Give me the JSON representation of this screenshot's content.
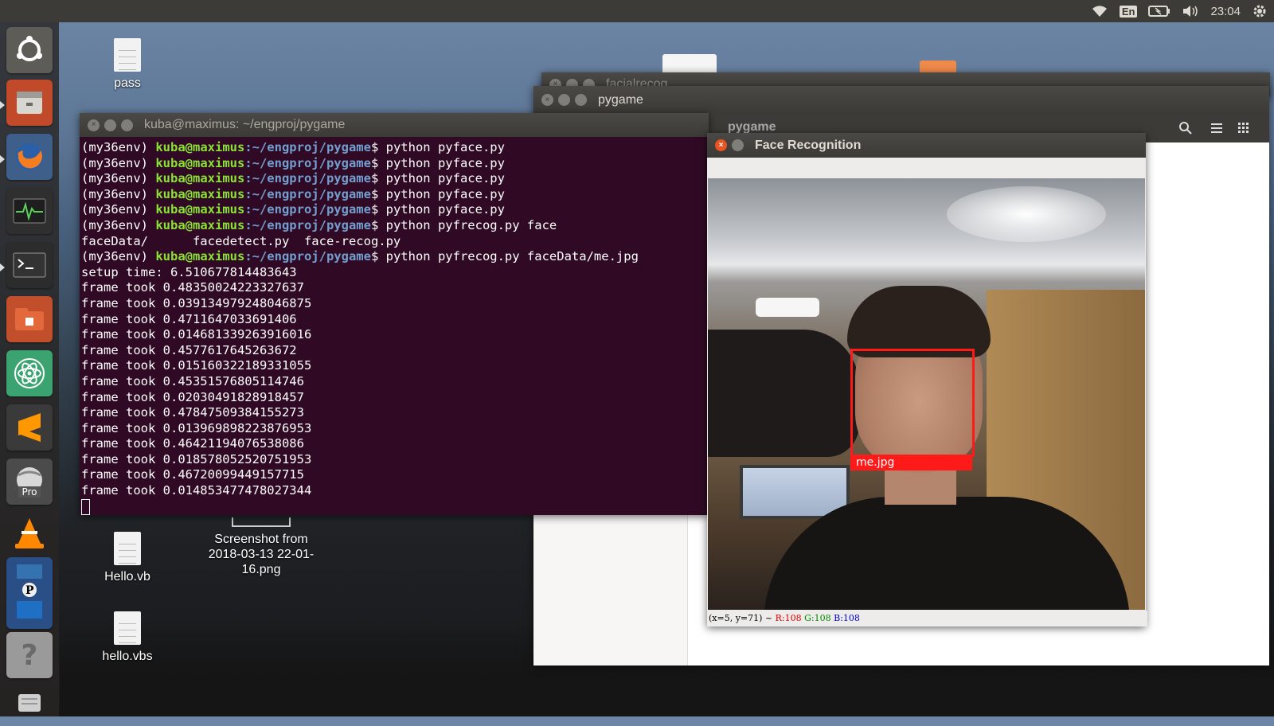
{
  "top_panel": {
    "keyboard_layout": "En",
    "clock": "23:04"
  },
  "desktop": {
    "icons": [
      {
        "label": "pass"
      },
      {
        "label": "Hello.vb"
      },
      {
        "label": "Screenshot from 2018-03-13 22-01-16.png"
      },
      {
        "label": "hello.vbs"
      }
    ]
  },
  "launcher": {
    "items": [
      "Ubuntu",
      "Files",
      "Firefox",
      "System Monitor",
      "Terminal",
      "Archive",
      "Atom",
      "Sublime Text",
      "Google Earth Pro",
      "VLC",
      "Visual Studio Code",
      "Help",
      "Trash"
    ],
    "pro_badge": "Pro"
  },
  "windows": {
    "back1": {
      "title": "facialrecog"
    },
    "back2": {
      "title": "pygame"
    },
    "file_manager": {
      "tab": "pygame"
    }
  },
  "terminal": {
    "title": "kuba@maximus: ~/engproj/pygame",
    "prompt": {
      "env": "(my36env) ",
      "user": "kuba@maximus",
      "path": ":~/engproj/pygame",
      "symbol": "$ "
    },
    "commands": [
      "python pyface.py",
      "python pyface.py",
      "python pyface.py",
      "python pyface.py",
      "python pyface.py",
      "python pyfrecog.py face"
    ],
    "completion": "faceData/      facedetect.py  face-recog.py",
    "last_command": "python pyfrecog.py faceData/me.jpg",
    "output": [
      "setup time: 6.510677814483643",
      "frame took 0.48350024223327637",
      "frame took 0.039134979248046875",
      "frame took 0.4711647033691406",
      "frame took 0.014681339263916016",
      "frame took 0.4577617645263672",
      "frame took 0.015160322189331055",
      "frame took 0.45351576805114746",
      "frame took 0.02030491828918457",
      "frame took 0.47847509384155273",
      "frame took 0.013969898223876953",
      "frame took 0.46421194076538086",
      "frame took 0.018578052520751953",
      "frame took 0.46720099449157715",
      "frame took 0.014853477478027344"
    ]
  },
  "face_window": {
    "title": "Face Recognition",
    "detection_label": "me.jpg",
    "box_color": "#ff1a1a",
    "status": {
      "coords": "(x=5, y=71) ~ ",
      "r": "R:108",
      "g": "G:108",
      "b": "B:108"
    }
  }
}
